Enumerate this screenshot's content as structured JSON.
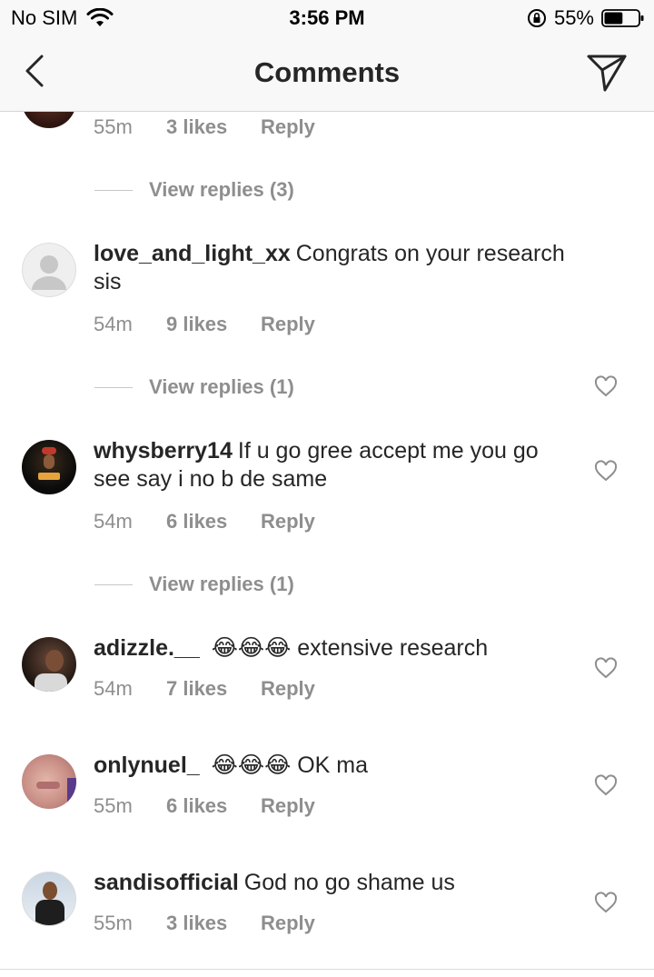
{
  "status_bar": {
    "carrier": "No SIM",
    "time": "3:56 PM",
    "battery": "55%",
    "battery_level": 0.55,
    "icons": [
      "wifi-icon",
      "rotation-lock-icon",
      "battery-icon"
    ]
  },
  "nav": {
    "title": "Comments",
    "back_icon": "chevron-left-icon",
    "share_icon": "paper-plane-icon"
  },
  "top_partial": {
    "time": "55m",
    "likes": "3 likes",
    "reply": "Reply",
    "view_replies": "View replies (3)"
  },
  "comments": [
    {
      "username": "love_and_light_xx",
      "text": "Congrats on your research sis",
      "time": "54m",
      "likes": "9 likes",
      "reply": "Reply",
      "view_replies": "View replies (1)",
      "avatar": "default-avatar"
    },
    {
      "username": "whysberry14",
      "text": "If u go gree accept me you go see say i no b de same",
      "time": "54m",
      "likes": "6 likes",
      "reply": "Reply",
      "view_replies": "View replies (1)",
      "avatar": "photo-avatar"
    },
    {
      "username": "adizzle.__",
      "emoji": "😂😂😂",
      "text": "extensive research",
      "time": "54m",
      "likes": "7 likes",
      "reply": "Reply",
      "avatar": "photo-avatar"
    },
    {
      "username": "onlynuel_",
      "emoji": "😂😂😂",
      "text": "OK ma",
      "time": "55m",
      "likes": "6 likes",
      "reply": "Reply",
      "avatar": "photo-avatar"
    },
    {
      "username": "sandisofficial",
      "text": "God no go shame us",
      "time": "55m",
      "likes": "3 likes",
      "reply": "Reply",
      "avatar": "photo-avatar"
    }
  ],
  "colors": {
    "text": "#262626",
    "meta": "#8e8e8e",
    "bar_background": "#f8f8f8",
    "divider": "#d4d4d4"
  }
}
